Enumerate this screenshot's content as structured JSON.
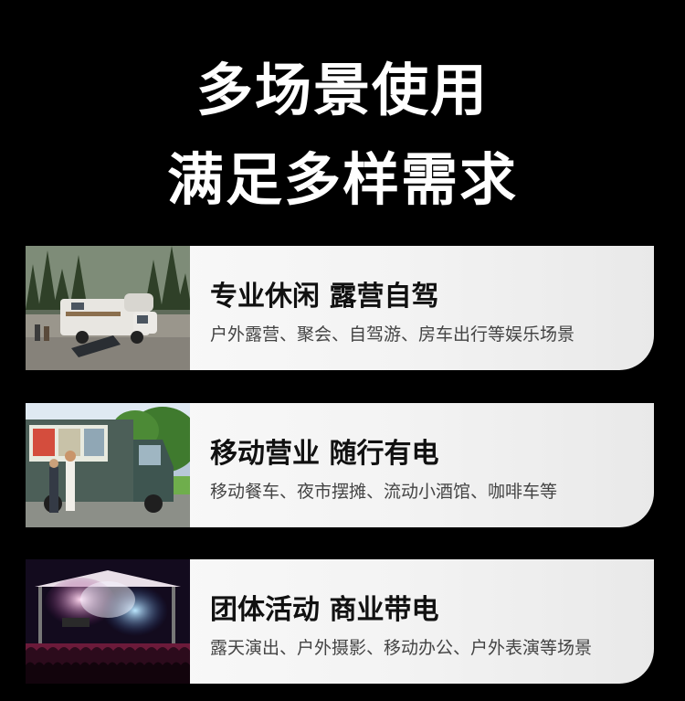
{
  "heading": {
    "line1": "多场景使用",
    "line2": "满足多样需求"
  },
  "cards": [
    {
      "title": "专业休闲 露营自驾",
      "subtitle": "户外露营、聚会、自驾游、房车出行等娱乐场景",
      "photo_icon": "rv-camping-photo"
    },
    {
      "title": "移动营业 随行有电",
      "subtitle": "移动餐车、夜市摆摊、流动小酒馆、咖啡车等",
      "photo_icon": "food-truck-photo"
    },
    {
      "title": "团体活动 商业带电",
      "subtitle": "露天演出、户外摄影、移动办公、户外表演等场景",
      "photo_icon": "concert-stage-photo"
    }
  ],
  "colors": {
    "background": "#000000",
    "heading_text": "#ffffff",
    "card_background": "#f3f3f3",
    "card_title": "#111111",
    "card_subtitle": "#444444"
  }
}
